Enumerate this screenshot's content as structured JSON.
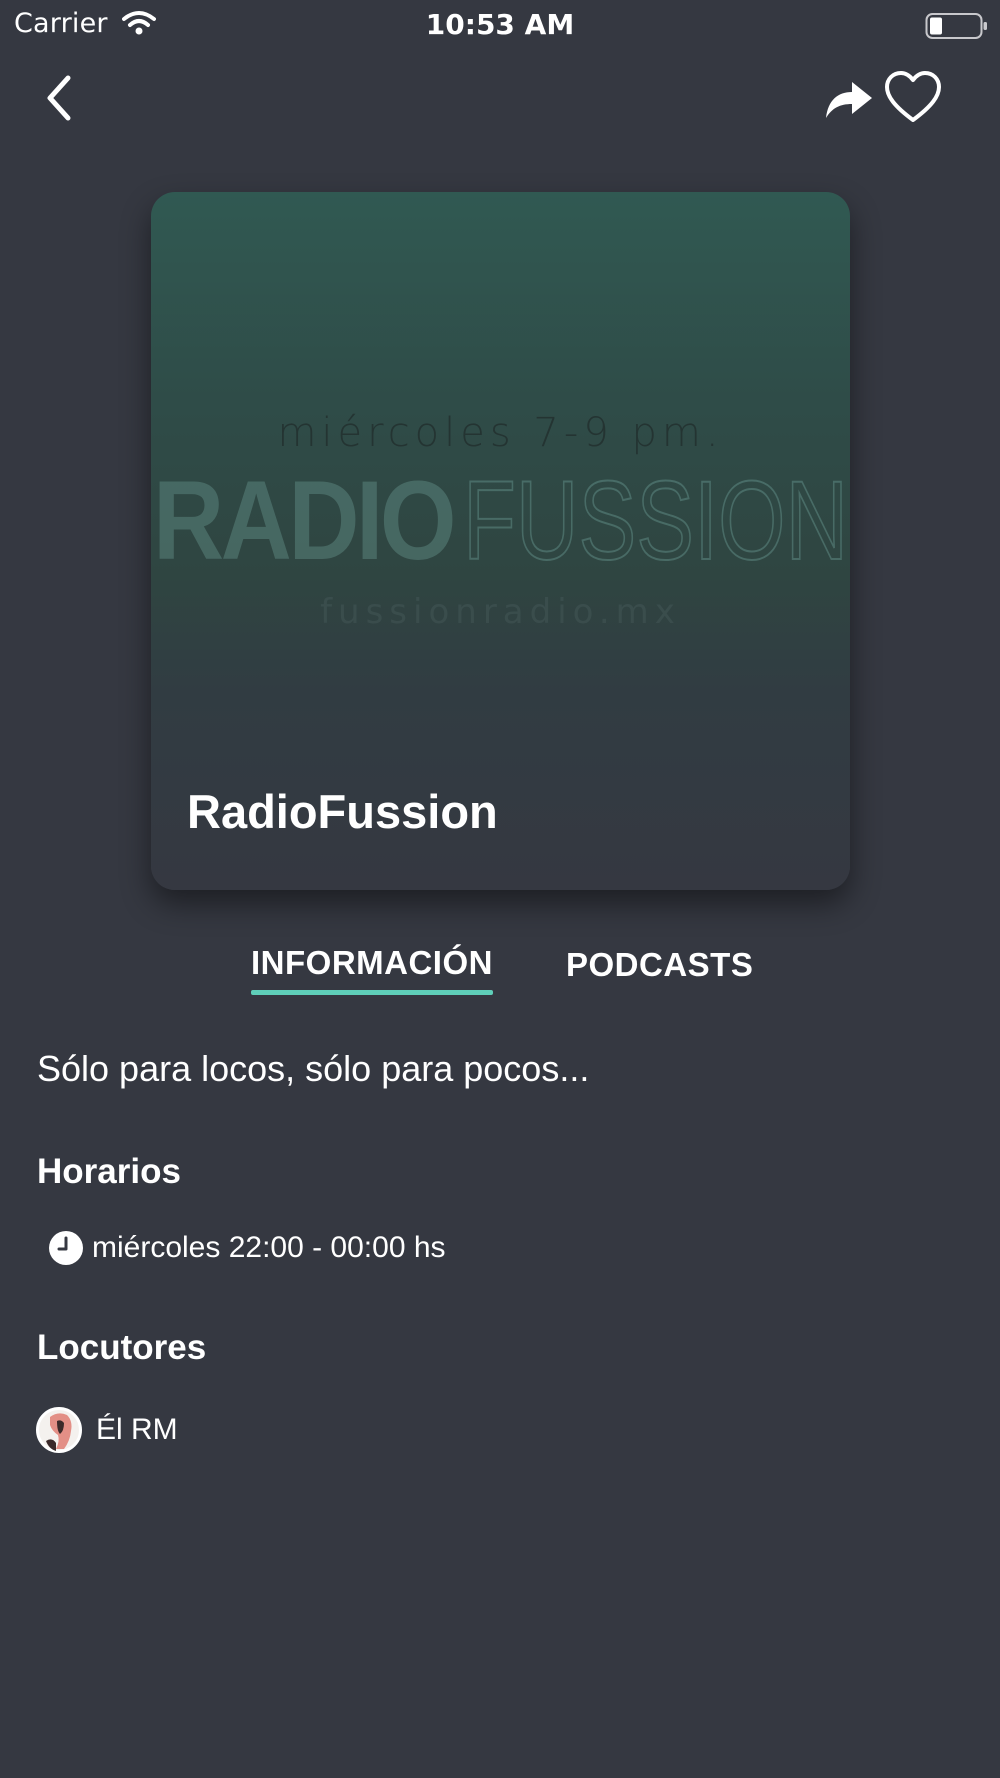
{
  "status_bar": {
    "carrier": "Carrier",
    "time": "10:53 AM",
    "icons": [
      "wifi-icon",
      "battery-icon"
    ]
  },
  "nav": {
    "icons": [
      "back-icon",
      "share-icon",
      "heart-icon"
    ]
  },
  "cover": {
    "art_line_1": "miércoles 7-9 pm.",
    "logo_bold": "RADIO",
    "logo_light": "FUSSION",
    "art_line_2": "fussionradio.mx",
    "title": "RadioFussion"
  },
  "tabs": [
    {
      "label": "INFORMACIÓN",
      "selected": true
    },
    {
      "label": "PODCASTS",
      "selected": false
    }
  ],
  "info": {
    "tagline": "Sólo para locos, sólo para pocos...",
    "schedule_heading": "Horarios",
    "schedule": [
      "miércoles 22:00 - 00:00 hs"
    ],
    "hosts_heading": "Locutores",
    "hosts": [
      "Él RM"
    ]
  },
  "colors": {
    "background": "#353841",
    "accent": "#5fcfb9",
    "text": "#ffffff"
  }
}
